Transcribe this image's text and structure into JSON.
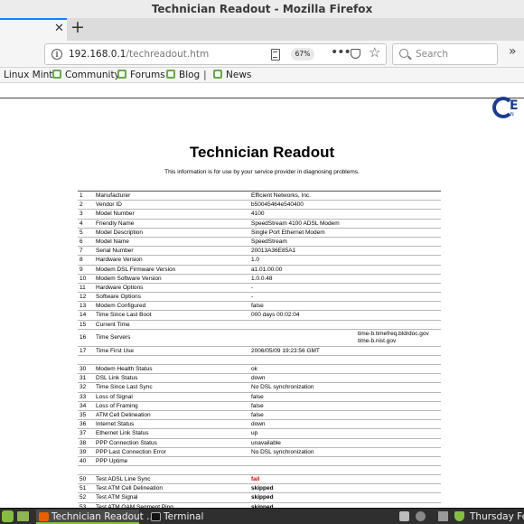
{
  "window": {
    "title": "Technician Readout - Mozilla Firefox"
  },
  "tabs": {
    "new_tab_label": "+"
  },
  "nav": {
    "url_host": "192.168.0.1",
    "url_path": "/techreadout.htm",
    "zoom": "67%",
    "search_placeholder": "Search"
  },
  "bookmarks": [
    {
      "label": "Linux Mint"
    },
    {
      "label": "Community"
    },
    {
      "label": "Forums"
    },
    {
      "label": "Blog"
    },
    {
      "label": "News"
    }
  ],
  "page": {
    "logo_text": "E",
    "logo_sub": "N",
    "title": "Technician Readout",
    "subtitle": "This information is for use by your service provider in diagnosing problems."
  },
  "readout_rows": [
    {
      "num": "1",
      "label": "Manufacturer",
      "value": "Efficient Networks, Inc."
    },
    {
      "num": "2",
      "label": "Vendor ID",
      "value": "b50045464e540400"
    },
    {
      "num": "3",
      "label": "Model Number",
      "value": "4100"
    },
    {
      "num": "4",
      "label": "Friendly Name",
      "value": "SpeedStream 4100 ADSL Modem"
    },
    {
      "num": "5",
      "label": "Model Description",
      "value": "Single Port Ethernet Modem"
    },
    {
      "num": "6",
      "label": "Model Name",
      "value": "SpeedStream"
    },
    {
      "num": "7",
      "label": "Serial Number",
      "value": "20013A36E85A1"
    },
    {
      "num": "8",
      "label": "Hardware Version",
      "value": "1.0"
    },
    {
      "num": "9",
      "label": "Modem DSL Firmware Version",
      "value": "a1.01.00.00"
    },
    {
      "num": "10",
      "label": "Modem Software Version",
      "value": "1.0.0.48"
    },
    {
      "num": "11",
      "label": "Hardware Options",
      "value": "-"
    },
    {
      "num": "12",
      "label": "Software Options",
      "value": "-"
    },
    {
      "num": "13",
      "label": "Modem Configured",
      "value": "false"
    },
    {
      "num": "14",
      "label": "Time Since Last Boot",
      "value": "000 days 00:02:04"
    },
    {
      "num": "15",
      "label": "Current Time",
      "value": ""
    },
    {
      "num": "16",
      "label": "Time Servers",
      "value": "",
      "side1": "time-b.timefreq.bldrdoc.gov",
      "side2": "time-b.nist.gov"
    },
    {
      "num": "17",
      "label": "Time First Use",
      "value": "2006/05/09 19:23:56 GMT"
    },
    {
      "num": "30",
      "label": "Modem Health Status",
      "value": "ok"
    },
    {
      "num": "31",
      "label": "DSL Link Status",
      "value": "down"
    },
    {
      "num": "32",
      "label": "Time Since Last Sync",
      "value": "No DSL synchronization"
    },
    {
      "num": "33",
      "label": "Loss of Signal",
      "value": "false"
    },
    {
      "num": "34",
      "label": "Loss of Framing",
      "value": "false"
    },
    {
      "num": "35",
      "label": "ATM Cell Delineation",
      "value": "false"
    },
    {
      "num": "36",
      "label": "Internet Status",
      "value": "down"
    },
    {
      "num": "37",
      "label": "Ethernet Link Status",
      "value": "up"
    },
    {
      "num": "38",
      "label": "PPP Connection Status",
      "value": "unavailable"
    },
    {
      "num": "39",
      "label": "PPP Last Connection Error",
      "value": "No DSL synchronization"
    },
    {
      "num": "40",
      "label": "PPP Uptime",
      "value": ""
    },
    {
      "num": "50",
      "label": "Test ADSL Line Sync",
      "value": "fail"
    },
    {
      "num": "51",
      "label": "Test ATM Cell Delineation",
      "value": "skipped"
    },
    {
      "num": "52",
      "label": "Test ATM Signal",
      "value": "skipped"
    },
    {
      "num": "53",
      "label": "Test ATM OAM Segment Ping",
      "value": "skipped"
    }
  ],
  "taskbar": {
    "tasks": [
      {
        "label": "Technician Readout ..."
      },
      {
        "label": "Terminal"
      }
    ],
    "clock": "Thursday Feb"
  },
  "colors": {
    "accent": "#0a84ff",
    "fail": "#d40000",
    "mint": "#86be43",
    "logo": "#1d3d8f"
  }
}
